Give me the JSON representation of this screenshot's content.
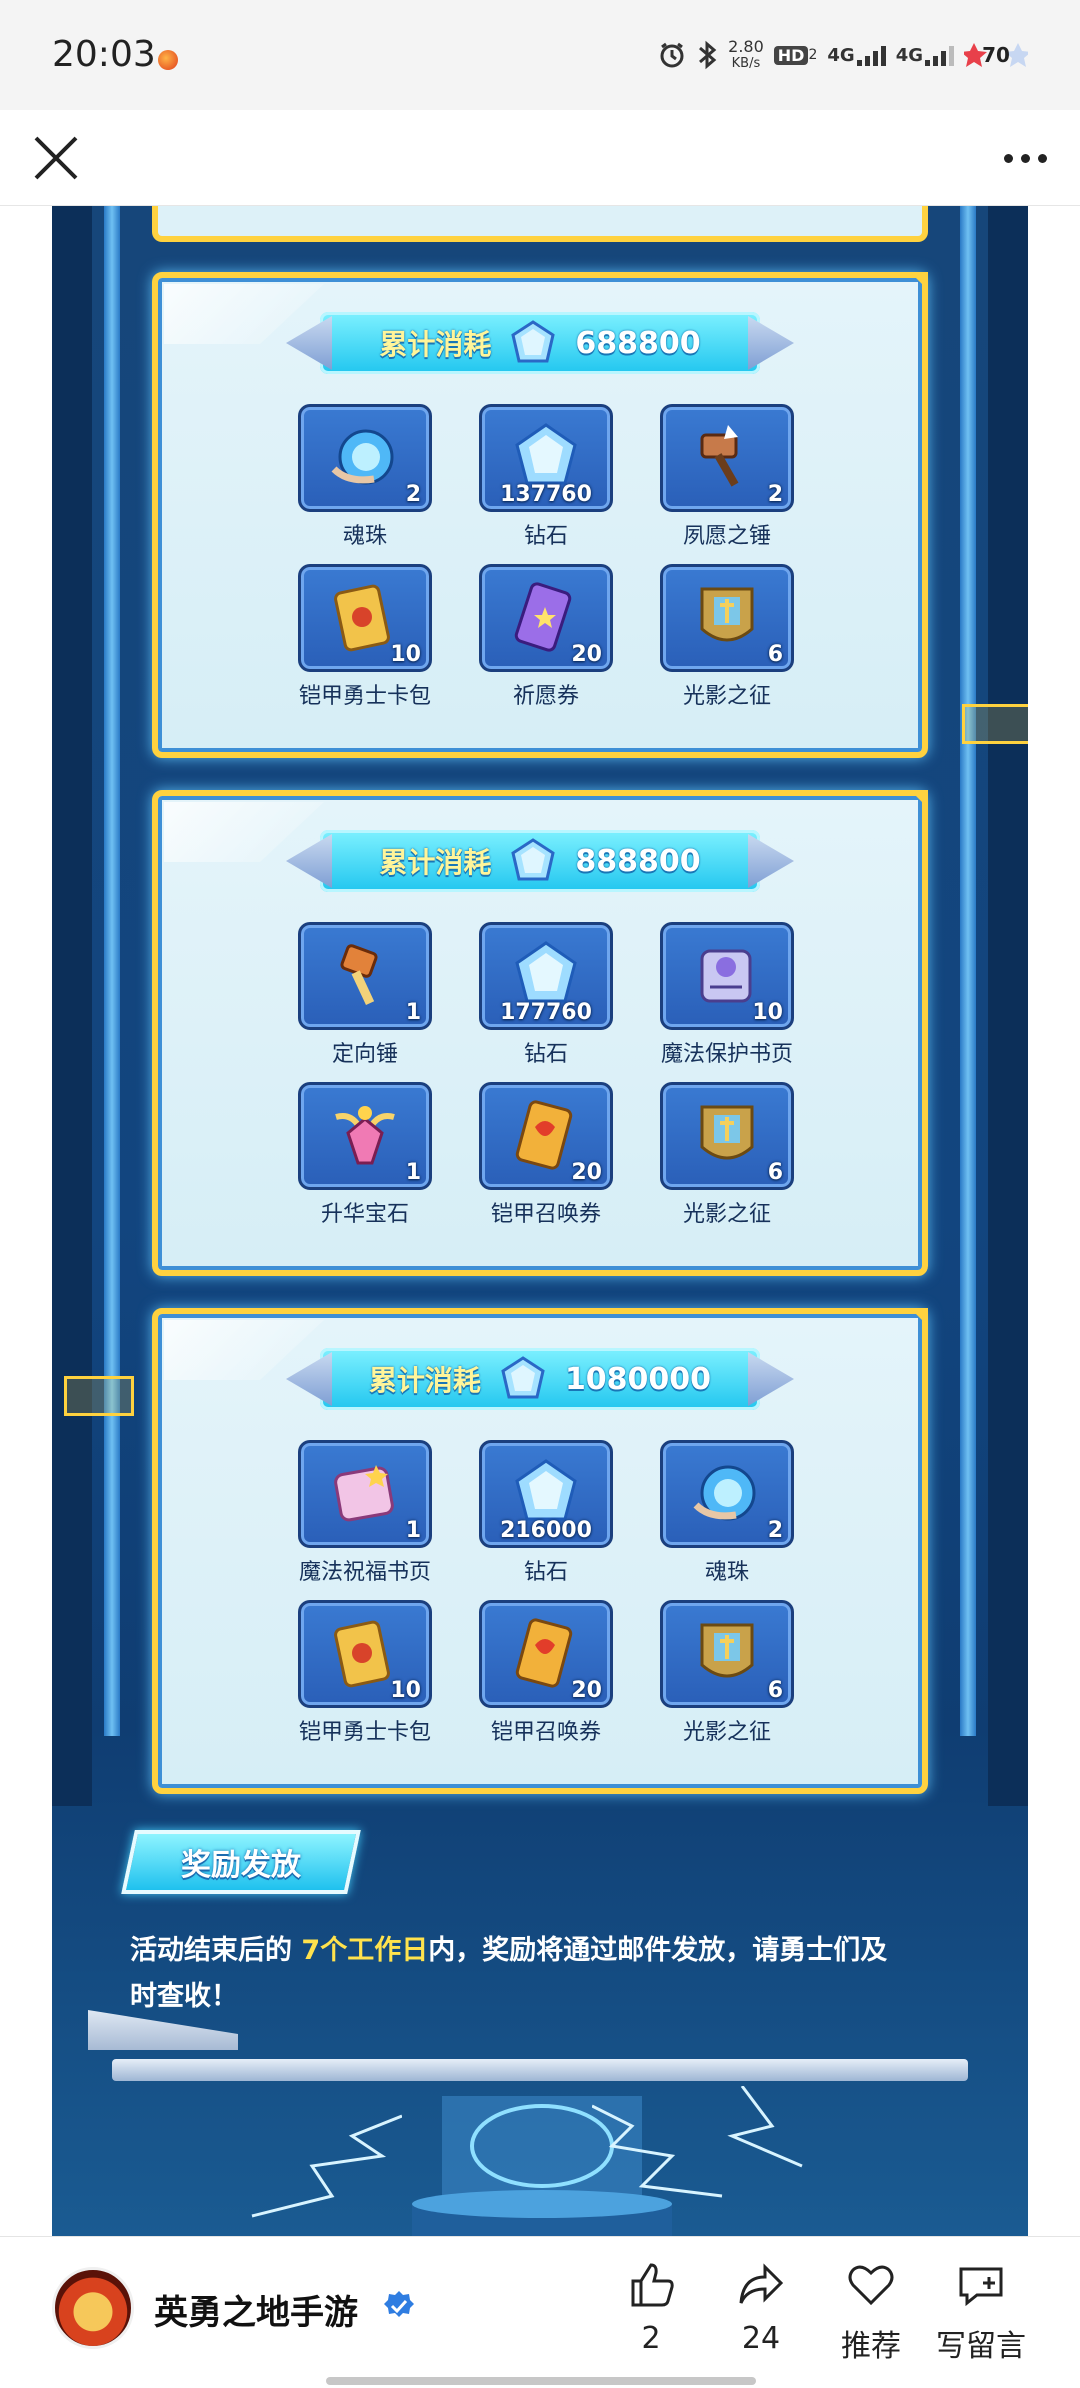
{
  "status_bar": {
    "time": "20:03",
    "net_speed_value": "2.80",
    "net_speed_unit": "KB/s",
    "hd_label": "HD",
    "hd_sub": "2",
    "signal_1": "4G",
    "signal_2": "4G",
    "battery": "70"
  },
  "panels": [
    {
      "label": "累计消耗",
      "value": "688800",
      "items": [
        {
          "name": "魂珠",
          "qty": "2",
          "icon": "soul-orb-icon"
        },
        {
          "name": "钻石",
          "qty": "137760",
          "icon": "diamond-icon"
        },
        {
          "name": "夙愿之锤",
          "qty": "2",
          "icon": "wish-hammer-icon"
        },
        {
          "name": "铠甲勇士卡包",
          "qty": "10",
          "icon": "card-pack-icon"
        },
        {
          "name": "祈愿券",
          "qty": "20",
          "icon": "wish-ticket-icon"
        },
        {
          "name": "光影之征",
          "qty": "6",
          "icon": "shield-emblem-icon"
        }
      ]
    },
    {
      "label": "累计消耗",
      "value": "888800",
      "items": [
        {
          "name": "定向锤",
          "qty": "1",
          "icon": "directed-hammer-icon"
        },
        {
          "name": "钻石",
          "qty": "177760",
          "icon": "diamond-icon"
        },
        {
          "name": "魔法保护书页",
          "qty": "10",
          "icon": "protect-scroll-icon"
        },
        {
          "name": "升华宝石",
          "qty": "1",
          "icon": "sublimation-gem-icon"
        },
        {
          "name": "铠甲召唤券",
          "qty": "20",
          "icon": "summon-ticket-icon"
        },
        {
          "name": "光影之征",
          "qty": "6",
          "icon": "shield-emblem-icon"
        }
      ]
    },
    {
      "label": "累计消耗",
      "value": "1080000",
      "items": [
        {
          "name": "魔法祝福书页",
          "qty": "1",
          "icon": "blessing-scroll-icon"
        },
        {
          "name": "钻石",
          "qty": "216000",
          "icon": "diamond-icon"
        },
        {
          "name": "魂珠",
          "qty": "2",
          "icon": "soul-orb-icon"
        },
        {
          "name": "铠甲勇士卡包",
          "qty": "10",
          "icon": "card-pack-icon"
        },
        {
          "name": "铠甲召唤券",
          "qty": "20",
          "icon": "summon-ticket-icon"
        },
        {
          "name": "光影之征",
          "qty": "6",
          "icon": "shield-emblem-icon"
        }
      ]
    }
  ],
  "reward": {
    "tag": "奖励发放",
    "text_before": "活动结束后的 ",
    "text_highlight": "7个工作日",
    "text_after": "内，奖励将通过邮件发放，请勇士们及时查收！"
  },
  "footer": {
    "account_name": "英勇之地手游",
    "like_count": "2",
    "share_count": "24",
    "recommend_label": "推荐",
    "comment_label": "写留言"
  },
  "colors": {
    "panel_border": "#ffd23f",
    "banner": "#21c6ef",
    "highlight": "#ffe24d",
    "background": "#12457f"
  }
}
